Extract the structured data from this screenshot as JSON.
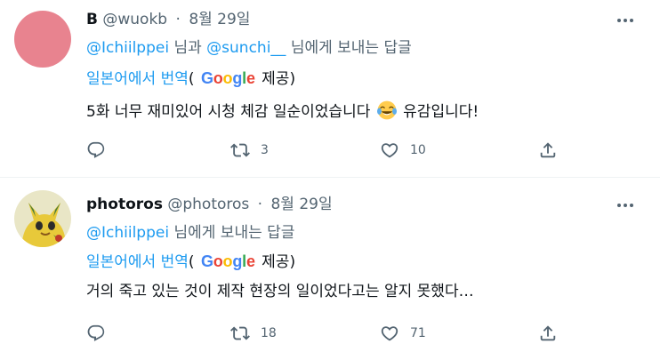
{
  "tweets": [
    {
      "avatar_color": "#e8838f",
      "name": "B",
      "handle": "@wuokb",
      "separator": "·",
      "date": "8월 29일",
      "reply_mentions": [
        "@Ichiilppei",
        "@sunchi__"
      ],
      "reply_joiner": "님과",
      "reply_suffix": "님에게 보내는 답글",
      "translate_label": "일본어에서 번역",
      "translate_open": "(",
      "translate_provider_suffix": "제공)",
      "text_before_emoji": "5화 너무 재미있어 시청 체감 일순이었습니다",
      "emoji_icon": "face-with-tears-of-joy-icon",
      "text_after_emoji": "유감입니다!",
      "replies": "",
      "retweets": "3",
      "likes": "10"
    },
    {
      "name": "photoros",
      "handle": "@photoros",
      "separator": "·",
      "date": "8월 29일",
      "reply_mention": "@Ichiilppei",
      "reply_suffix": "님에게 보내는 답글",
      "translate_label": "일본어에서 번역",
      "translate_open": "(",
      "translate_provider_suffix": "제공)",
      "text": "거의 죽고 있는 것이 제작 현장의 일이었다고는 알지 못했다…",
      "replies": "",
      "retweets": "18",
      "likes": "71"
    }
  ],
  "google_logo": [
    "G",
    "o",
    "o",
    "g",
    "l",
    "e"
  ],
  "colors": {
    "accent": "#1d9bf0",
    "secondary_text": "#536471",
    "primary_text": "#0f1419",
    "divider": "#eff3f4"
  }
}
